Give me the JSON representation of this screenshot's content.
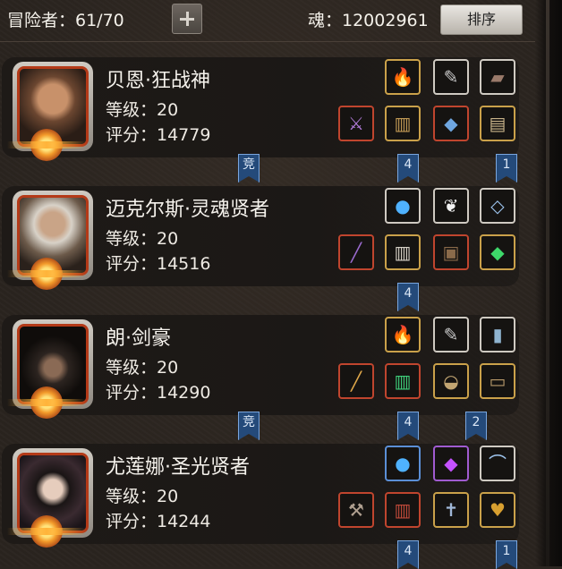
{
  "header": {
    "adventurers_text": "冒险者：61/70",
    "soul_text": "魂：12002961",
    "sort_label": "排序"
  },
  "heroes": [
    {
      "name": "贝恩·狂战神",
      "level": "等级：20",
      "score": "评分：14779",
      "portrait": "bald-warrior-portrait",
      "equip_top": [
        {
          "icon": "flame-orb-icon",
          "glyph": "🔥",
          "color": "#ff7a1a"
        },
        {
          "icon": "feather-icon",
          "glyph": "✎",
          "color": "#c9c9c9"
        },
        {
          "icon": "cloak-icon",
          "glyph": "▰",
          "color": "#9a7a6a"
        }
      ],
      "equip_bottom": [
        {
          "icon": "mace-icon",
          "glyph": "⚔",
          "color": "#b07ad8"
        },
        {
          "icon": "armor-icon",
          "glyph": "▥",
          "color": "#c29a55"
        },
        {
          "icon": "bracer-icon",
          "glyph": "◆",
          "color": "#6fa6e0"
        },
        {
          "icon": "gauntlet-icon",
          "glyph": "▤",
          "color": "#c9b48a"
        }
      ],
      "tags": [
        {
          "text": "竞"
        },
        {
          "text": "4"
        },
        {
          "text": "1"
        }
      ]
    },
    {
      "name": "迈克尔斯·灵魂贤者",
      "level": "等级：20",
      "score": "评分：14516",
      "portrait": "bearded-sage-portrait",
      "equip_top": [
        {
          "icon": "blue-orb-icon",
          "glyph": "●",
          "color": "#4fb2ff"
        },
        {
          "icon": "white-wing-icon",
          "glyph": "❦",
          "color": "#f2f2f2"
        },
        {
          "icon": "necklace-icon",
          "glyph": "◇",
          "color": "#9fc6f0"
        }
      ],
      "equip_bottom": [
        {
          "icon": "staff-icon",
          "glyph": "╱",
          "color": "#9b6bd0"
        },
        {
          "icon": "robe-icon",
          "glyph": "▥",
          "color": "#d8d2c8"
        },
        {
          "icon": "book-icon",
          "glyph": "▣",
          "color": "#8a6a4a"
        },
        {
          "icon": "green-gem-icon",
          "glyph": "◆",
          "color": "#3ed86a"
        }
      ],
      "tags": [
        {
          "text": "4"
        }
      ]
    },
    {
      "name": "朗·剑豪",
      "level": "等级：20",
      "score": "评分：14290",
      "portrait": "hooded-swordsman-portrait",
      "equip_top": [
        {
          "icon": "flame-orb-icon",
          "glyph": "🔥",
          "color": "#ff7a1a"
        },
        {
          "icon": "feather-icon",
          "glyph": "✎",
          "color": "#c9c9c9"
        },
        {
          "icon": "card-icon",
          "glyph": "▮",
          "color": "#8fb4d0"
        }
      ],
      "equip_bottom": [
        {
          "icon": "sword-icon",
          "glyph": "╱",
          "color": "#e0a84a"
        },
        {
          "icon": "green-armor-icon",
          "glyph": "▥",
          "color": "#3fcf7a"
        },
        {
          "icon": "helmet-icon",
          "glyph": "◒",
          "color": "#c2a572"
        },
        {
          "icon": "belt-icon",
          "glyph": "▭",
          "color": "#b89a6a"
        }
      ],
      "tags": [
        {
          "text": "竞"
        },
        {
          "text": "4"
        },
        {
          "text": "2"
        }
      ]
    },
    {
      "name": "尤莲娜·圣光贤者",
      "level": "等级：20",
      "score": "评分：14244",
      "portrait": "dark-haired-priestess-portrait",
      "equip_top": [
        {
          "icon": "blue-orb-icon",
          "glyph": "●",
          "color": "#4fb2ff"
        },
        {
          "icon": "purple-gem-icon",
          "glyph": "◆",
          "color": "#c452ff"
        },
        {
          "icon": "bow-icon",
          "glyph": "⌒",
          "color": "#9fc6f0"
        }
      ],
      "equip_bottom": [
        {
          "icon": "hammer-icon",
          "glyph": "⚒",
          "color": "#b0a090"
        },
        {
          "icon": "red-robe-icon",
          "glyph": "▥",
          "color": "#c04a3a"
        },
        {
          "icon": "wand-icon",
          "glyph": "✝",
          "color": "#a0b8d8"
        },
        {
          "icon": "heart-amulet-icon",
          "glyph": "♥",
          "color": "#d8a030"
        }
      ],
      "tags": [
        {
          "text": "4"
        },
        {
          "text": "1"
        }
      ]
    }
  ]
}
